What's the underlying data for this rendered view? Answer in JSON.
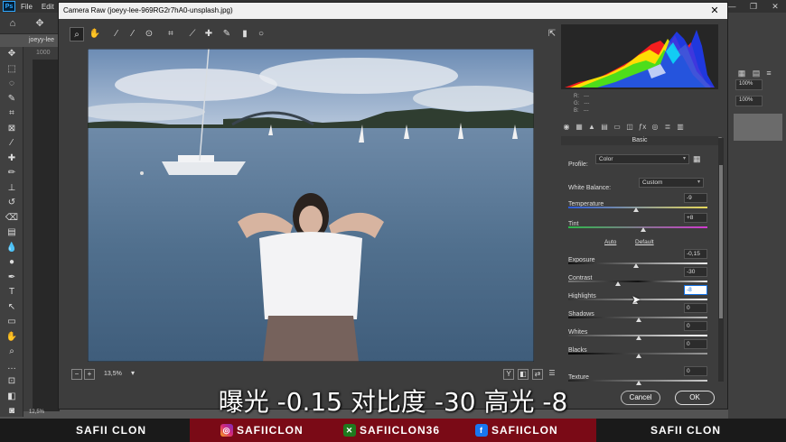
{
  "menubar": {
    "logo": "Ps",
    "items": [
      "File",
      "Edit"
    ]
  },
  "document": {
    "tab_name": "joeyy-lee",
    "ruler_label": "1000",
    "zoom_status": "12,5%"
  },
  "camera_raw": {
    "title": "Camera Raw (joeyy-lee-969RG2r7hA0-unsplash.jpg)",
    "zoom_level": "13,5%",
    "rgb": {
      "r_label": "R:",
      "g_label": "G:",
      "b_label": "B:",
      "r": "---",
      "g": "---",
      "b": "---"
    },
    "panel_title": "Basic",
    "profile": {
      "label": "Profile:",
      "value": "Color"
    },
    "white_balance": {
      "label": "White Balance:",
      "value": "Custom"
    },
    "auto_label": "Auto",
    "default_label": "Default",
    "sliders": [
      {
        "label": "Temperature",
        "value": "-9"
      },
      {
        "label": "Tint",
        "value": "+8"
      },
      {
        "label": "Exposure",
        "value": "-0,15"
      },
      {
        "label": "Contrast",
        "value": "-30"
      },
      {
        "label": "Highlights",
        "value": "-8"
      },
      {
        "label": "Shadows",
        "value": "0"
      },
      {
        "label": "Whites",
        "value": "0"
      },
      {
        "label": "Blacks",
        "value": "0"
      },
      {
        "label": "Texture",
        "value": "0"
      }
    ],
    "cancel_label": "Cancel",
    "ok_label": "OK"
  },
  "right_panel": {
    "opacity_1": "100%",
    "opacity_2": "100%"
  },
  "subtitle": "曝光 -0.15 对比度 -30 高光 -8",
  "banner": {
    "left_name": "SAFII CLON",
    "instagram": "SAFIICLON",
    "xbox": "SAFIICLON36",
    "facebook": "SAFIICLON",
    "right_name": "SAFII CLON"
  }
}
